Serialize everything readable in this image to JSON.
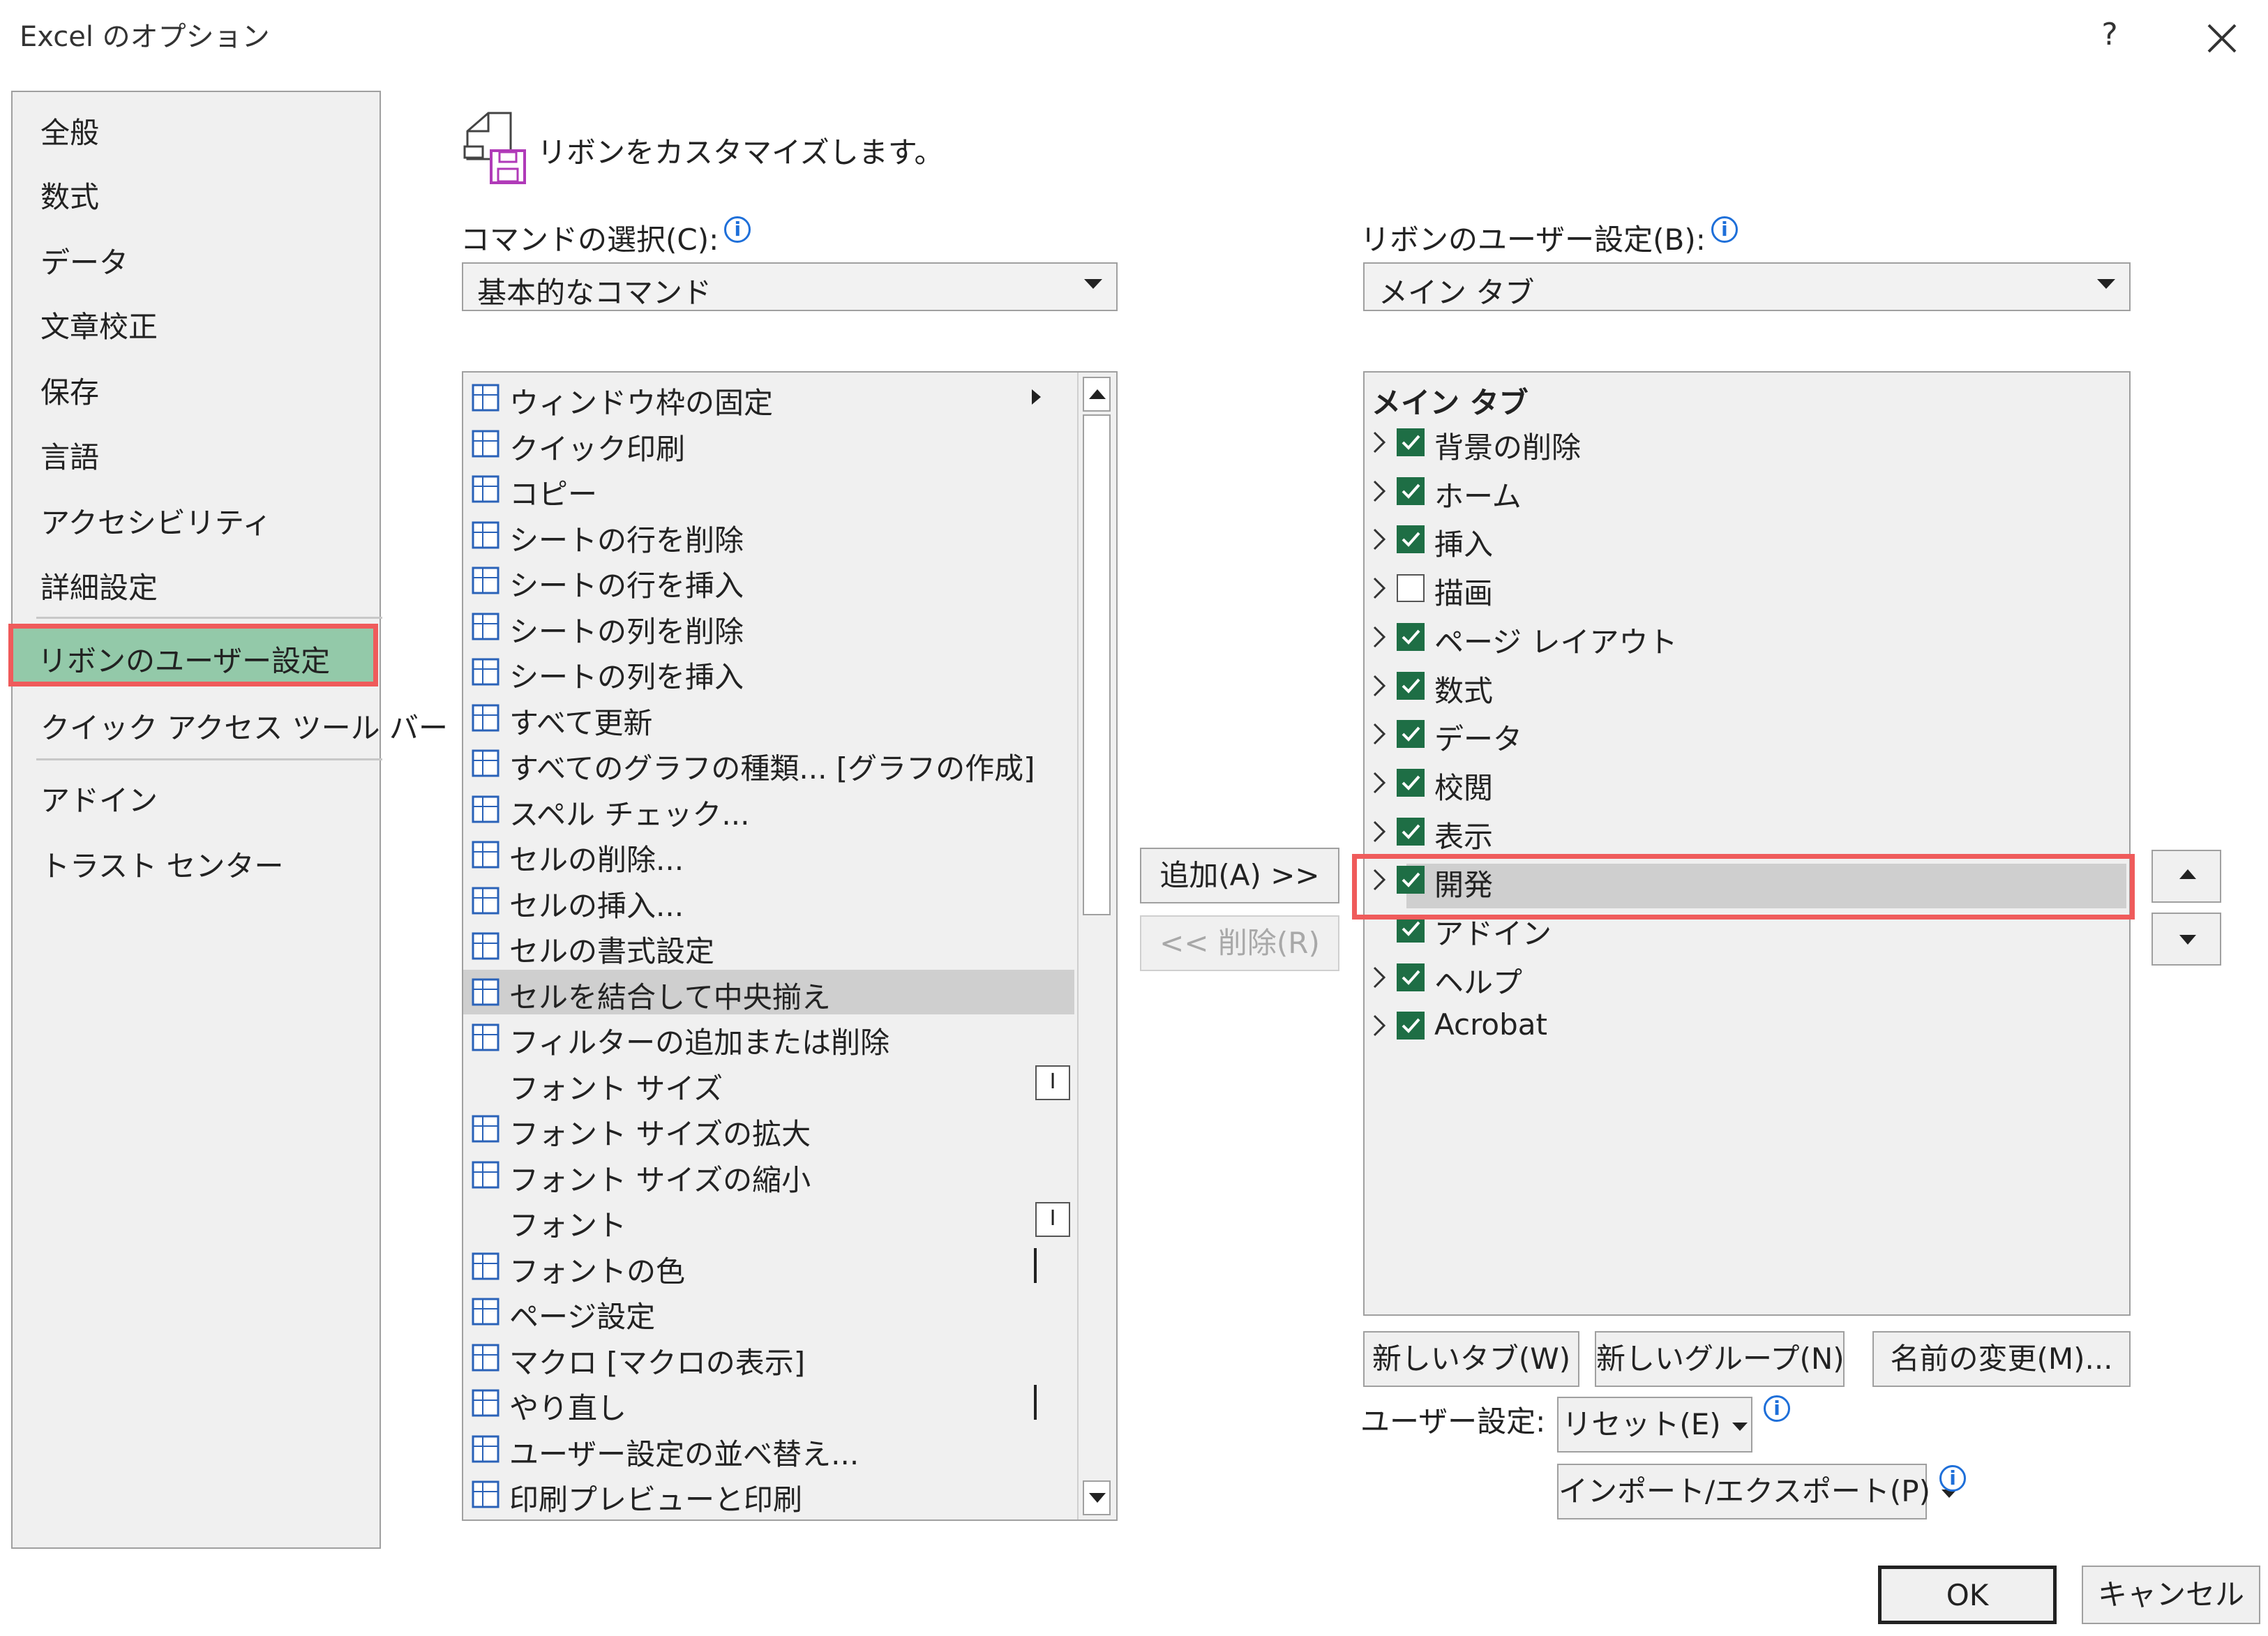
{
  "window": {
    "title": "Excel のオプション",
    "help": "?"
  },
  "sidebar": {
    "items": [
      {
        "label": "全般"
      },
      {
        "label": "数式"
      },
      {
        "label": "データ"
      },
      {
        "label": "文章校正"
      },
      {
        "label": "保存"
      },
      {
        "label": "言語"
      },
      {
        "label": "アクセシビリティ"
      },
      {
        "label": "詳細設定"
      },
      {
        "label": "リボンのユーザー設定"
      },
      {
        "label": "クイック アクセス ツール バー"
      },
      {
        "label": "アドイン"
      },
      {
        "label": "トラスト センター"
      }
    ],
    "active_index": 8
  },
  "header": {
    "text": "リボンをカスタマイズします。"
  },
  "commands": {
    "label": "コマンドの選択(C):",
    "selected": "基本的なコマンド",
    "items": [
      {
        "label": "ウィンドウ枠の固定",
        "icon": "freeze-panes-icon"
      },
      {
        "label": "クイック印刷",
        "icon": "quick-print-icon"
      },
      {
        "label": "コピー",
        "icon": "copy-icon"
      },
      {
        "label": "シートの行を削除",
        "icon": "delete-row-icon"
      },
      {
        "label": "シートの行を挿入",
        "icon": "insert-row-icon"
      },
      {
        "label": "シートの列を削除",
        "icon": "delete-column-icon"
      },
      {
        "label": "シートの列を挿入",
        "icon": "insert-column-icon"
      },
      {
        "label": "すべて更新",
        "icon": "refresh-all-icon"
      },
      {
        "label": "すべてのグラフの種類... [グラフの作成]",
        "icon": "chart-icon"
      },
      {
        "label": "スペル チェック...",
        "icon": "spell-check-icon"
      },
      {
        "label": "セルの削除...",
        "icon": "delete-cells-icon"
      },
      {
        "label": "セルの挿入...",
        "icon": "insert-cells-icon"
      },
      {
        "label": "セルの書式設定",
        "icon": "format-cells-icon"
      },
      {
        "label": "セルを結合して中央揃え",
        "icon": "merge-center-icon"
      },
      {
        "label": "フィルターの追加または削除",
        "icon": "filter-icon"
      },
      {
        "label": "フォント サイズ",
        "icon": ""
      },
      {
        "label": "フォント サイズの拡大",
        "icon": "font-grow-icon"
      },
      {
        "label": "フォント サイズの縮小",
        "icon": "font-shrink-icon"
      },
      {
        "label": "フォント",
        "icon": ""
      },
      {
        "label": "フォントの色",
        "icon": "font-color-icon"
      },
      {
        "label": "ページ設定",
        "icon": "page-setup-icon"
      },
      {
        "label": "マクロ [マクロの表示]",
        "icon": "macro-icon"
      },
      {
        "label": "やり直し",
        "icon": "redo-icon"
      },
      {
        "label": "ユーザー設定の並べ替え...",
        "icon": "custom-sort-icon"
      },
      {
        "label": "印刷プレビューと印刷",
        "icon": "print-preview-icon"
      }
    ],
    "selected_index": 13
  },
  "actions": {
    "add": "追加(A) >>",
    "remove": "<< 削除(R)"
  },
  "ribbon": {
    "label": "リボンのユーザー設定(B):",
    "selected": "メイン タブ",
    "root": "メイン タブ",
    "tabs": [
      {
        "label": "背景の削除",
        "checked": true,
        "expandable": true
      },
      {
        "label": "ホーム",
        "checked": true,
        "expandable": true
      },
      {
        "label": "挿入",
        "checked": true,
        "expandable": true
      },
      {
        "label": "描画",
        "checked": false,
        "expandable": true
      },
      {
        "label": "ページ レイアウト",
        "checked": true,
        "expandable": true
      },
      {
        "label": "数式",
        "checked": true,
        "expandable": true
      },
      {
        "label": "データ",
        "checked": true,
        "expandable": true
      },
      {
        "label": "校閲",
        "checked": true,
        "expandable": true
      },
      {
        "label": "表示",
        "checked": true,
        "expandable": true
      },
      {
        "label": "開発",
        "checked": true,
        "expandable": true
      },
      {
        "label": "アドイン",
        "checked": true,
        "expandable": false
      },
      {
        "label": "ヘルプ",
        "checked": true,
        "expandable": true
      },
      {
        "label": "Acrobat",
        "checked": true,
        "expandable": true
      }
    ],
    "selected_index": 9
  },
  "tree_buttons": {
    "new_tab": "新しいタブ(W)",
    "new_group": "新しいグループ(N)",
    "rename": "名前の変更(M)..."
  },
  "user_settings": {
    "label": "ユーザー設定:",
    "reset": "リセット(E)",
    "import_export": "インポート/エクスポート(P)"
  },
  "footer": {
    "ok": "OK",
    "cancel": "キャンセル"
  },
  "colors": {
    "highlight_border": "#ef5b5b",
    "active_nav": "#93c9a9",
    "checkbox": "#1e6e45",
    "info": "#1e6fd9"
  }
}
